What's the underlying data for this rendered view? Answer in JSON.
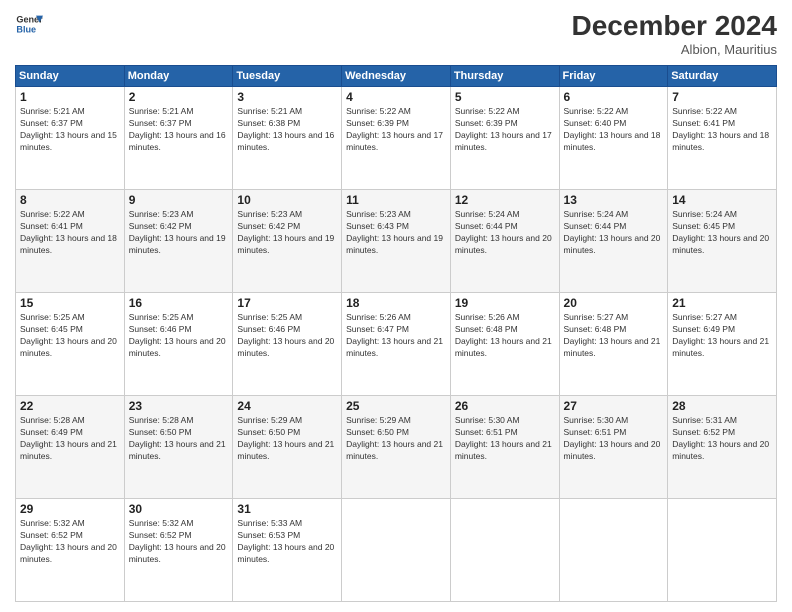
{
  "header": {
    "logo_line1": "General",
    "logo_line2": "Blue",
    "month": "December 2024",
    "location": "Albion, Mauritius"
  },
  "weekdays": [
    "Sunday",
    "Monday",
    "Tuesday",
    "Wednesday",
    "Thursday",
    "Friday",
    "Saturday"
  ],
  "weeks": [
    [
      {
        "day": "1",
        "rise": "5:21 AM",
        "set": "6:37 PM",
        "daylight": "13 hours and 15 minutes."
      },
      {
        "day": "2",
        "rise": "5:21 AM",
        "set": "6:37 PM",
        "daylight": "13 hours and 16 minutes."
      },
      {
        "day": "3",
        "rise": "5:21 AM",
        "set": "6:38 PM",
        "daylight": "13 hours and 16 minutes."
      },
      {
        "day": "4",
        "rise": "5:22 AM",
        "set": "6:39 PM",
        "daylight": "13 hours and 17 minutes."
      },
      {
        "day": "5",
        "rise": "5:22 AM",
        "set": "6:39 PM",
        "daylight": "13 hours and 17 minutes."
      },
      {
        "day": "6",
        "rise": "5:22 AM",
        "set": "6:40 PM",
        "daylight": "13 hours and 18 minutes."
      },
      {
        "day": "7",
        "rise": "5:22 AM",
        "set": "6:41 PM",
        "daylight": "13 hours and 18 minutes."
      }
    ],
    [
      {
        "day": "8",
        "rise": "5:22 AM",
        "set": "6:41 PM",
        "daylight": "13 hours and 18 minutes."
      },
      {
        "day": "9",
        "rise": "5:23 AM",
        "set": "6:42 PM",
        "daylight": "13 hours and 19 minutes."
      },
      {
        "day": "10",
        "rise": "5:23 AM",
        "set": "6:42 PM",
        "daylight": "13 hours and 19 minutes."
      },
      {
        "day": "11",
        "rise": "5:23 AM",
        "set": "6:43 PM",
        "daylight": "13 hours and 19 minutes."
      },
      {
        "day": "12",
        "rise": "5:24 AM",
        "set": "6:44 PM",
        "daylight": "13 hours and 20 minutes."
      },
      {
        "day": "13",
        "rise": "5:24 AM",
        "set": "6:44 PM",
        "daylight": "13 hours and 20 minutes."
      },
      {
        "day": "14",
        "rise": "5:24 AM",
        "set": "6:45 PM",
        "daylight": "13 hours and 20 minutes."
      }
    ],
    [
      {
        "day": "15",
        "rise": "5:25 AM",
        "set": "6:45 PM",
        "daylight": "13 hours and 20 minutes."
      },
      {
        "day": "16",
        "rise": "5:25 AM",
        "set": "6:46 PM",
        "daylight": "13 hours and 20 minutes."
      },
      {
        "day": "17",
        "rise": "5:25 AM",
        "set": "6:46 PM",
        "daylight": "13 hours and 20 minutes."
      },
      {
        "day": "18",
        "rise": "5:26 AM",
        "set": "6:47 PM",
        "daylight": "13 hours and 21 minutes."
      },
      {
        "day": "19",
        "rise": "5:26 AM",
        "set": "6:48 PM",
        "daylight": "13 hours and 21 minutes."
      },
      {
        "day": "20",
        "rise": "5:27 AM",
        "set": "6:48 PM",
        "daylight": "13 hours and 21 minutes."
      },
      {
        "day": "21",
        "rise": "5:27 AM",
        "set": "6:49 PM",
        "daylight": "13 hours and 21 minutes."
      }
    ],
    [
      {
        "day": "22",
        "rise": "5:28 AM",
        "set": "6:49 PM",
        "daylight": "13 hours and 21 minutes."
      },
      {
        "day": "23",
        "rise": "5:28 AM",
        "set": "6:50 PM",
        "daylight": "13 hours and 21 minutes."
      },
      {
        "day": "24",
        "rise": "5:29 AM",
        "set": "6:50 PM",
        "daylight": "13 hours and 21 minutes."
      },
      {
        "day": "25",
        "rise": "5:29 AM",
        "set": "6:50 PM",
        "daylight": "13 hours and 21 minutes."
      },
      {
        "day": "26",
        "rise": "5:30 AM",
        "set": "6:51 PM",
        "daylight": "13 hours and 21 minutes."
      },
      {
        "day": "27",
        "rise": "5:30 AM",
        "set": "6:51 PM",
        "daylight": "13 hours and 20 minutes."
      },
      {
        "day": "28",
        "rise": "5:31 AM",
        "set": "6:52 PM",
        "daylight": "13 hours and 20 minutes."
      }
    ],
    [
      {
        "day": "29",
        "rise": "5:32 AM",
        "set": "6:52 PM",
        "daylight": "13 hours and 20 minutes."
      },
      {
        "day": "30",
        "rise": "5:32 AM",
        "set": "6:52 PM",
        "daylight": "13 hours and 20 minutes."
      },
      {
        "day": "31",
        "rise": "5:33 AM",
        "set": "6:53 PM",
        "daylight": "13 hours and 20 minutes."
      },
      null,
      null,
      null,
      null
    ]
  ]
}
